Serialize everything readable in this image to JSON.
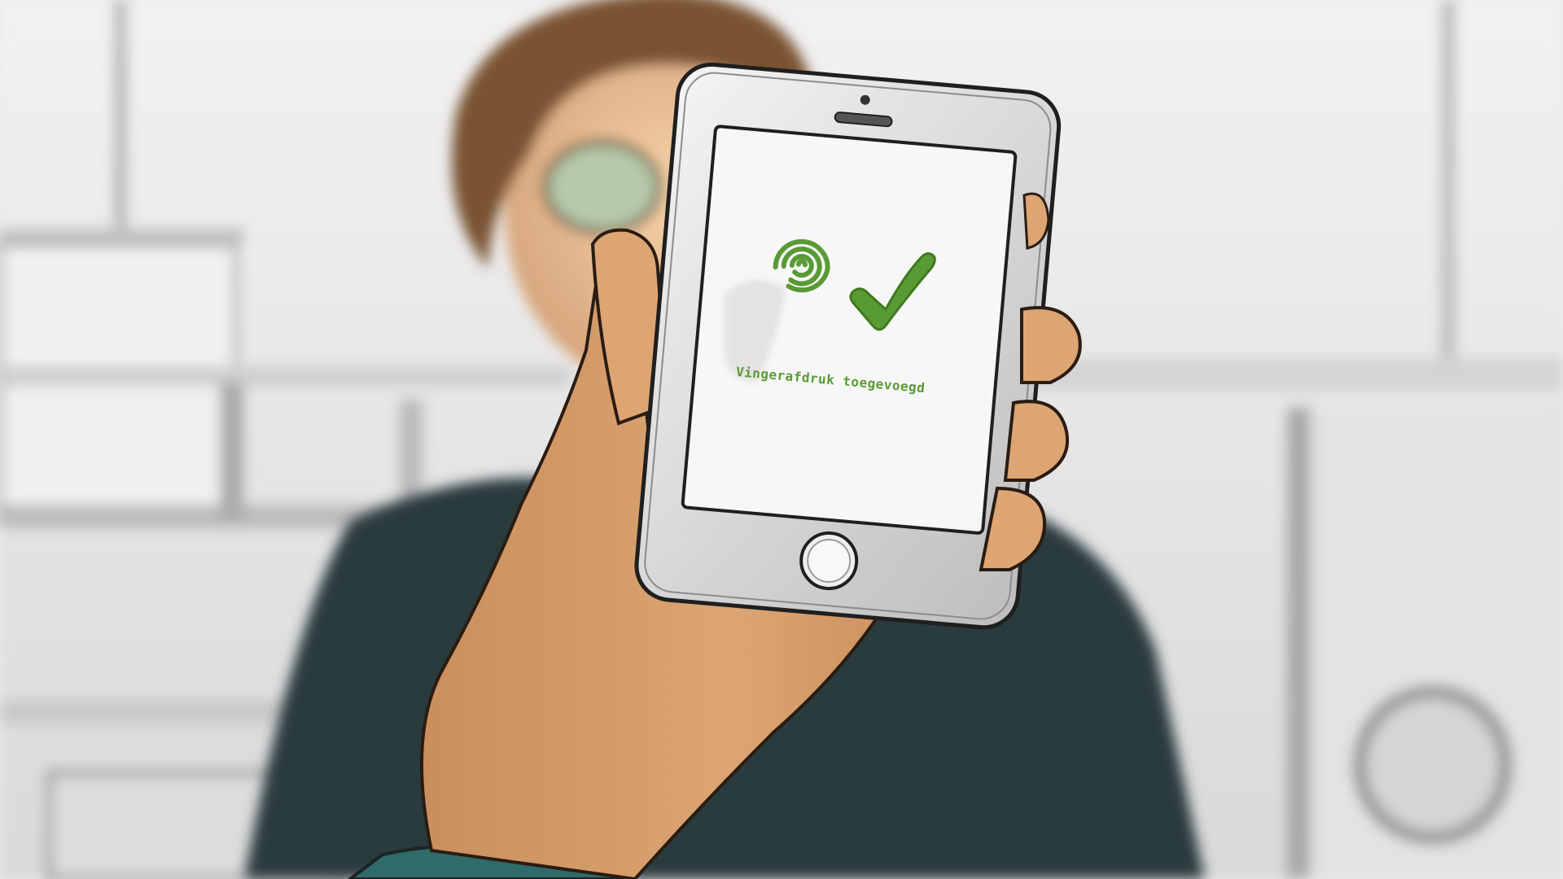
{
  "screen": {
    "status_message": "Vingerafdruk toegevoegd"
  },
  "icons": {
    "fingerprint": "fingerprint-icon",
    "success": "checkmark-icon"
  },
  "colors": {
    "accent_green": "#5a9a35",
    "skin": "#d9a06c",
    "jacket": "#2b3a3e"
  }
}
